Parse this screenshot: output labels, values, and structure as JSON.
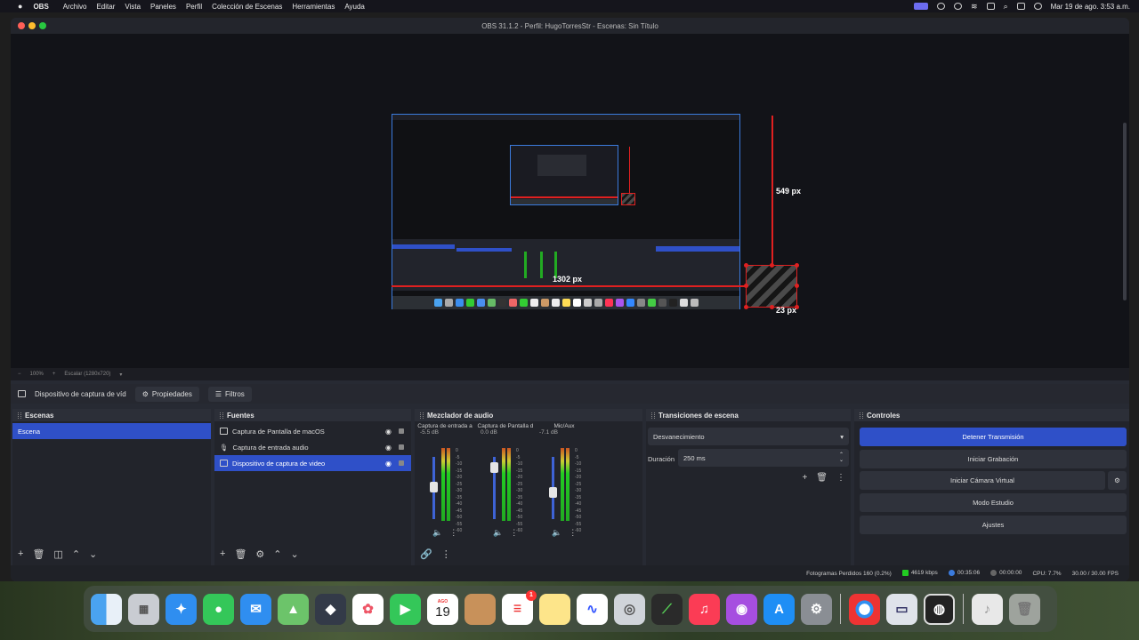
{
  "menubar": {
    "app": "OBS",
    "items": [
      "Archivo",
      "Editar",
      "Vista",
      "Paneles",
      "Perfil",
      "Colección de Escenas",
      "Herramientas",
      "Ayuda"
    ],
    "clock": "Mar 19 de ago.  3:53 a.m."
  },
  "window": {
    "title": "OBS 31.1.2 - Perfil: HugoTorresStr - Escenas: Sin Título"
  },
  "preview": {
    "measure_height": "549 px",
    "measure_width": "1302 px",
    "measure_box": "23 px"
  },
  "zoom": {
    "minus": "−",
    "level": "100%",
    "plus": "+",
    "mode": "Escalar (1280x720)"
  },
  "source_toolbar": {
    "selected_source": "Dispositivo de captura de víd",
    "properties": "Propiedades",
    "filters": "Filtros"
  },
  "scenes": {
    "title": "Escenas",
    "items": [
      "Escena"
    ]
  },
  "sources": {
    "title": "Fuentes",
    "items": [
      "Captura de Pantalla de macOS",
      "Captura de entrada audio",
      "Dispositivo de captura de video"
    ]
  },
  "mixer": {
    "title": "Mezclador de audio",
    "channels": [
      {
        "name": "Captura de entrada a",
        "db": "-5.5 dB",
        "level": 0.55
      },
      {
        "name": "Captura de Pantalla d",
        "db": "0.0 dB",
        "level": 0.9
      },
      {
        "name": "Mic/Aux",
        "db": "-7.1 dB",
        "level": 0.45
      }
    ],
    "scale": [
      "0",
      "-5",
      "-10",
      "-15",
      "-20",
      "-25",
      "-30",
      "-35",
      "-40",
      "-45",
      "-50",
      "-55",
      "-60"
    ]
  },
  "transitions": {
    "title": "Transiciones de escena",
    "selected": "Desvanecimiento",
    "duration_label": "Duración",
    "duration_value": "250 ms"
  },
  "controls": {
    "title": "Controles",
    "stop_stream": "Detener Transmisión",
    "start_recording": "Iniciar Grabación",
    "start_virtualcam": "Iniciar Cámara Virtual",
    "studio_mode": "Modo Estudio",
    "settings": "Ajustes"
  },
  "status": {
    "dropped": "Fotogramas Perdidos 160 (0.2%)",
    "bitrate": "4619 kbps",
    "stream_time": "00:35:06",
    "rec_time": "00:00:00",
    "cpu": "CPU: 7.7%",
    "fps": "30.00 / 30.00 FPS"
  },
  "dock": {
    "calendar_month": "AGO",
    "calendar_day": "19",
    "reminders_badge": "1",
    "apps": [
      "finder-icon",
      "launchpad-icon",
      "safari-icon",
      "messages-icon",
      "mail-icon",
      "maps-icon",
      "davinci-icon",
      "photos-icon",
      "facetime-icon",
      "calendar-icon",
      "contacts-icon",
      "reminders-icon",
      "notes-icon",
      "freeform-icon",
      "preview-icon",
      "xcode-icon",
      "music-icon",
      "podcasts-icon",
      "appstore-icon",
      "settings-icon",
      "chrome-icon",
      "virtualbuddy-icon",
      "obs-icon",
      "downloads-icon",
      "trash-icon"
    ]
  },
  "colors": {
    "accent": "#2f50c8",
    "measure": "#e02020",
    "panel": "#22242b"
  }
}
